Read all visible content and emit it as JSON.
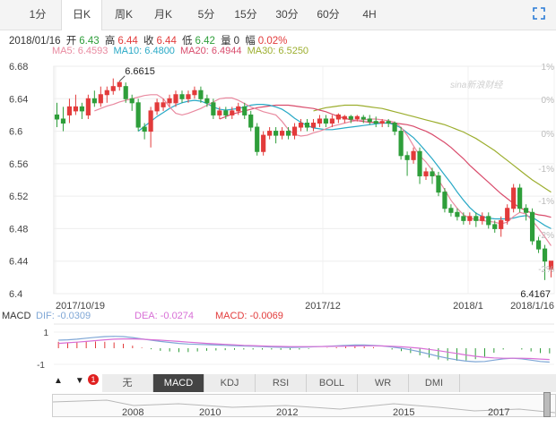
{
  "tabs": [
    {
      "label": "1分"
    },
    {
      "label": "日K"
    },
    {
      "label": "周K"
    },
    {
      "label": "月K"
    },
    {
      "label": "5分"
    },
    {
      "label": "15分"
    },
    {
      "label": "30分"
    },
    {
      "label": "60分"
    },
    {
      "label": "4H"
    }
  ],
  "active_tab": "日K",
  "info": {
    "date": "2018/01/16",
    "open_label": "开",
    "open": "6.43",
    "high_label": "高",
    "high": "6.44",
    "close_label": "收",
    "close": "6.44",
    "low_label": "低",
    "low": "6.42",
    "volume_label": "量",
    "volume": "0",
    "change_label": "幅",
    "change": "0.02%"
  },
  "ma_line": {
    "ma5": "MA5: 6.4593",
    "ma10": "MA10: 6.4800",
    "ma20": "MA20: 6.4944",
    "ma30": "MA30: 6.5250"
  },
  "macd_line": {
    "label": "MACD",
    "dif": "DIF: -0.0309",
    "dea": "DEA: -0.0274",
    "macd": "MACD: -0.0069"
  },
  "watermark": "sina新浪财经",
  "indicator_buttons": [
    "无",
    "MACD",
    "KDJ",
    "RSI",
    "BOLL",
    "WR",
    "DMI"
  ],
  "active_indicator": "MACD",
  "badge_count": "1",
  "navigator_years": [
    "2008",
    "2010",
    "2012",
    "2015",
    "2017"
  ],
  "colors": {
    "up": "#e23b3b",
    "down": "#2e9e3a",
    "ma5": "#e98aa0",
    "ma10": "#29a9c6",
    "ma20": "#d94c6c",
    "ma30": "#9cae2e",
    "dif": "#7fa7d6",
    "dea": "#d86fd6"
  },
  "chart_data": {
    "type": "candlestick",
    "ylim": [
      6.4,
      6.68
    ],
    "yticks": [
      "6.68",
      "6.64",
      "6.6",
      "6.56",
      "6.52",
      "6.48",
      "6.44",
      "6.4"
    ],
    "pct_ticks": [
      "1%",
      "0%",
      "0%",
      "-1%",
      "-1%",
      "-2%",
      "-2%"
    ],
    "x_labels": [
      "2017/10/19",
      "2017/12",
      "2018/1",
      "2018/1/16"
    ],
    "annotations": [
      {
        "text": "6.6615",
        "value": 6.6615
      },
      {
        "text": "6.4167",
        "value": 6.4167
      }
    ],
    "candles": [
      [
        6.62,
        6.615,
        6.635,
        6.605
      ],
      [
        6.615,
        6.61,
        6.63,
        6.6
      ],
      [
        6.62,
        6.63,
        6.64,
        6.61
      ],
      [
        6.625,
        6.63,
        6.645,
        6.62
      ],
      [
        6.63,
        6.625,
        6.635,
        6.615
      ],
      [
        6.62,
        6.64,
        6.645,
        6.615
      ],
      [
        6.64,
        6.635,
        6.65,
        6.63
      ],
      [
        6.635,
        6.645,
        6.655,
        6.63
      ],
      [
        6.645,
        6.65,
        6.655,
        6.635
      ],
      [
        6.65,
        6.655,
        6.665,
        6.645
      ],
      [
        6.655,
        6.66,
        6.6615,
        6.65
      ],
      [
        6.655,
        6.64,
        6.66,
        6.635
      ],
      [
        6.64,
        6.635,
        6.645,
        6.625
      ],
      [
        6.635,
        6.605,
        6.64,
        6.6
      ],
      [
        6.605,
        6.6,
        6.61,
        6.59
      ],
      [
        6.6,
        6.625,
        6.63,
        6.58
      ],
      [
        6.625,
        6.635,
        6.64,
        6.62
      ],
      [
        6.63,
        6.635,
        6.64,
        6.625
      ],
      [
        6.635,
        6.64,
        6.645,
        6.63
      ],
      [
        6.635,
        6.645,
        6.65,
        6.63
      ],
      [
        6.645,
        6.64,
        6.65,
        6.635
      ],
      [
        6.64,
        6.645,
        6.65,
        6.635
      ],
      [
        6.645,
        6.65,
        6.655,
        6.64
      ],
      [
        6.65,
        6.64,
        6.655,
        6.635
      ],
      [
        6.64,
        6.635,
        6.645,
        6.63
      ],
      [
        6.635,
        6.62,
        6.64,
        6.615
      ],
      [
        6.62,
        6.625,
        6.63,
        6.615
      ],
      [
        6.625,
        6.62,
        6.63,
        6.615
      ],
      [
        6.62,
        6.625,
        6.63,
        6.615
      ],
      [
        6.625,
        6.63,
        6.635,
        6.62
      ],
      [
        6.63,
        6.62,
        6.635,
        6.615
      ],
      [
        6.62,
        6.605,
        6.625,
        6.6
      ],
      [
        6.605,
        6.575,
        6.61,
        6.57
      ],
      [
        6.575,
        6.595,
        6.6,
        6.57
      ],
      [
        6.595,
        6.6,
        6.605,
        6.59
      ],
      [
        6.6,
        6.595,
        6.605,
        6.585
      ],
      [
        6.595,
        6.6,
        6.605,
        6.59
      ],
      [
        6.6,
        6.595,
        6.605,
        6.59
      ],
      [
        6.595,
        6.605,
        6.61,
        6.59
      ],
      [
        6.605,
        6.61,
        6.615,
        6.6
      ],
      [
        6.61,
        6.605,
        6.615,
        6.6
      ],
      [
        6.605,
        6.61,
        6.615,
        6.6
      ],
      [
        6.61,
        6.615,
        6.62,
        6.605
      ],
      [
        6.615,
        6.61,
        6.62,
        6.605
      ],
      [
        6.61,
        6.615,
        6.62,
        6.605
      ],
      [
        6.615,
        6.62,
        6.622,
        6.61
      ],
      [
        6.615,
        6.618,
        6.62,
        6.61
      ],
      [
        6.618,
        6.615,
        6.62,
        6.61
      ],
      [
        6.615,
        6.618,
        6.62,
        6.612
      ],
      [
        6.617,
        6.615,
        6.62,
        6.61
      ],
      [
        6.615,
        6.612,
        6.62,
        6.608
      ],
      [
        6.612,
        6.61,
        6.618,
        6.605
      ],
      [
        6.61,
        6.612,
        6.615,
        6.605
      ],
      [
        6.612,
        6.61,
        6.615,
        6.605
      ],
      [
        6.61,
        6.6,
        6.612,
        6.595
      ],
      [
        6.6,
        6.57,
        6.605,
        6.565
      ],
      [
        6.57,
        6.565,
        6.575,
        6.545
      ],
      [
        6.565,
        6.575,
        6.58,
        6.56
      ],
      [
        6.575,
        6.545,
        6.58,
        6.535
      ],
      [
        6.545,
        6.55,
        6.555,
        6.54
      ],
      [
        6.55,
        6.545,
        6.555,
        6.535
      ],
      [
        6.545,
        6.525,
        6.55,
        6.52
      ],
      [
        6.525,
        6.505,
        6.53,
        6.5
      ],
      [
        6.505,
        6.5,
        6.51,
        6.495
      ],
      [
        6.5,
        6.495,
        6.505,
        6.49
      ],
      [
        6.495,
        6.49,
        6.5,
        6.485
      ],
      [
        6.49,
        6.495,
        6.5,
        6.485
      ],
      [
        6.495,
        6.49,
        6.5,
        6.482
      ],
      [
        6.49,
        6.495,
        6.5,
        6.485
      ],
      [
        6.495,
        6.485,
        6.5,
        6.48
      ],
      [
        6.485,
        6.48,
        6.49,
        6.475
      ],
      [
        6.48,
        6.49,
        6.495,
        6.47
      ],
      [
        6.49,
        6.505,
        6.51,
        6.485
      ],
      [
        6.505,
        6.53,
        6.535,
        6.5
      ],
      [
        6.53,
        6.505,
        6.535,
        6.5
      ],
      [
        6.505,
        6.5,
        6.51,
        6.49
      ],
      [
        6.5,
        6.465,
        6.505,
        6.46
      ],
      [
        6.465,
        6.455,
        6.47,
        6.45
      ],
      [
        6.455,
        6.44,
        6.46,
        6.4167
      ],
      [
        6.43,
        6.44,
        6.44,
        6.42
      ]
    ],
    "ma5": [
      6.625,
      6.628,
      6.631,
      6.633,
      6.636,
      6.638,
      6.64,
      6.642,
      6.644,
      6.645,
      6.645,
      6.64,
      6.63,
      6.622,
      6.62,
      6.622,
      6.625,
      6.628,
      6.632,
      6.636,
      6.64,
      6.641,
      6.641,
      6.638,
      6.634,
      6.63,
      6.627,
      6.624,
      6.622,
      6.62,
      6.612,
      6.602,
      6.596,
      6.594,
      6.595,
      6.598,
      6.6,
      6.603,
      6.606,
      6.608,
      6.61,
      6.612,
      6.613,
      6.614,
      6.615,
      6.615,
      6.614,
      6.613,
      6.611,
      6.605,
      6.595,
      6.582,
      6.57,
      6.562,
      6.552,
      6.54,
      6.528,
      6.515,
      6.505,
      6.497,
      6.493,
      6.491,
      6.49,
      6.489,
      6.488,
      6.486,
      6.488,
      6.495,
      6.5,
      6.498,
      6.49,
      6.48,
      6.47,
      6.459
    ],
    "ma10": [
      6.6,
      6.606,
      6.612,
      6.618,
      6.623,
      6.628,
      6.632,
      6.635,
      6.637,
      6.638,
      6.637,
      6.634,
      6.63,
      6.627,
      6.626,
      6.627,
      6.628,
      6.63,
      6.632,
      6.633,
      6.633,
      6.632,
      6.63,
      6.627,
      6.622,
      6.616,
      6.611,
      6.607,
      6.604,
      6.603,
      6.602,
      6.602,
      6.603,
      6.604,
      6.605,
      6.606,
      6.607,
      6.608,
      6.609,
      6.61,
      6.61,
      6.608,
      6.604,
      6.598,
      6.592,
      6.584,
      6.575,
      6.566,
      6.556,
      6.546,
      6.536,
      6.525,
      6.515,
      6.506,
      6.499,
      6.495,
      6.493,
      6.492,
      6.492,
      6.492,
      6.493,
      6.495,
      6.496,
      6.494,
      6.489,
      6.484,
      6.48
    ],
    "ma20": [
      6.615,
      6.618,
      6.621,
      6.623,
      6.625,
      6.627,
      6.629,
      6.63,
      6.631,
      6.632,
      6.632,
      6.632,
      6.631,
      6.63,
      6.629,
      6.628,
      6.626,
      6.624,
      6.621,
      6.618,
      6.616,
      6.614,
      6.613,
      6.612,
      6.611,
      6.611,
      6.61,
      6.61,
      6.61,
      6.609,
      6.608,
      6.606,
      6.603,
      6.6,
      6.596,
      6.591,
      6.586,
      6.58,
      6.573,
      6.566,
      6.558,
      6.551,
      6.544,
      6.537,
      6.53,
      6.523,
      6.517,
      6.511,
      6.506,
      6.502,
      6.499,
      6.497,
      6.496,
      6.494
    ],
    "ma30": [
      6.625,
      6.627,
      6.629,
      6.63,
      6.631,
      6.632,
      6.632,
      6.632,
      6.631,
      6.63,
      6.629,
      6.628,
      6.626,
      6.624,
      6.622,
      6.62,
      6.618,
      6.616,
      6.614,
      6.612,
      6.61,
      6.608,
      6.605,
      6.602,
      6.599,
      6.595,
      6.591,
      6.586,
      6.581,
      6.576,
      6.57,
      6.564,
      6.558,
      6.552,
      6.546,
      6.54,
      6.535,
      6.53,
      6.525
    ],
    "macd_yticks": [
      "1",
      "-1"
    ],
    "dif": [
      0.5,
      0.52,
      0.56,
      0.62,
      0.68,
      0.72,
      0.74,
      0.72,
      0.66,
      0.58,
      0.5,
      0.42,
      0.36,
      0.3,
      0.26,
      0.24,
      0.22,
      0.2,
      0.18,
      0.16,
      0.14,
      0.12,
      0.1,
      0.08,
      0.06,
      0.05,
      0.06,
      0.08,
      0.1,
      0.12,
      0.15,
      0.18,
      0.2,
      0.2,
      0.18,
      0.14,
      0.08,
      0.0,
      -0.1,
      -0.22,
      -0.36,
      -0.5,
      -0.62,
      -0.72,
      -0.8,
      -0.84,
      -0.82,
      -0.74,
      -0.66,
      -0.62,
      -0.66,
      -0.74,
      -0.82,
      -0.86
    ],
    "dea": [
      0.3,
      0.34,
      0.38,
      0.42,
      0.47,
      0.52,
      0.56,
      0.58,
      0.58,
      0.56,
      0.53,
      0.5,
      0.46,
      0.42,
      0.38,
      0.34,
      0.3,
      0.27,
      0.24,
      0.21,
      0.18,
      0.16,
      0.14,
      0.12,
      0.11,
      0.1,
      0.1,
      0.1,
      0.1,
      0.11,
      0.12,
      0.13,
      0.14,
      0.15,
      0.15,
      0.14,
      0.12,
      0.09,
      0.05,
      0.0,
      -0.07,
      -0.15,
      -0.24,
      -0.33,
      -0.42,
      -0.5,
      -0.56,
      -0.6,
      -0.62,
      -0.62,
      -0.62,
      -0.64,
      -0.67,
      -0.7
    ]
  }
}
